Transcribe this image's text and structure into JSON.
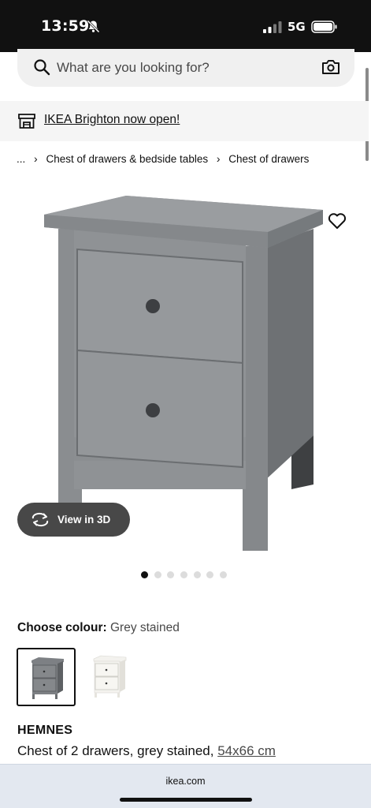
{
  "status_bar": {
    "time": "13:59",
    "network": "5G",
    "icons": [
      "bell-slash-icon",
      "signal-icon",
      "battery-icon"
    ]
  },
  "search": {
    "placeholder": "What are you looking for?",
    "icons": [
      "search-icon",
      "camera-icon"
    ]
  },
  "store_banner": {
    "text": "IKEA Brighton now open!",
    "icon": "store-icon"
  },
  "breadcrumb": {
    "ellipsis": "...",
    "items": [
      "Chest of drawers & bedside tables",
      "Chest of drawers"
    ]
  },
  "gallery": {
    "view_3d_label": "View in 3D",
    "dot_count": 7,
    "active_index": 0,
    "product_color": "#8f9295"
  },
  "colour": {
    "title": "Choose colour:",
    "value": "Grey stained",
    "options": [
      {
        "name": "grey-stained",
        "color": "#7d8084",
        "selected": true
      },
      {
        "name": "white-stained",
        "color": "#f1f0ec",
        "selected": false
      }
    ]
  },
  "product": {
    "name": "HEMNES",
    "description": "Chest of 2 drawers, grey stained,",
    "size": "54x66 cm"
  },
  "browser": {
    "url": "ikea.com"
  }
}
